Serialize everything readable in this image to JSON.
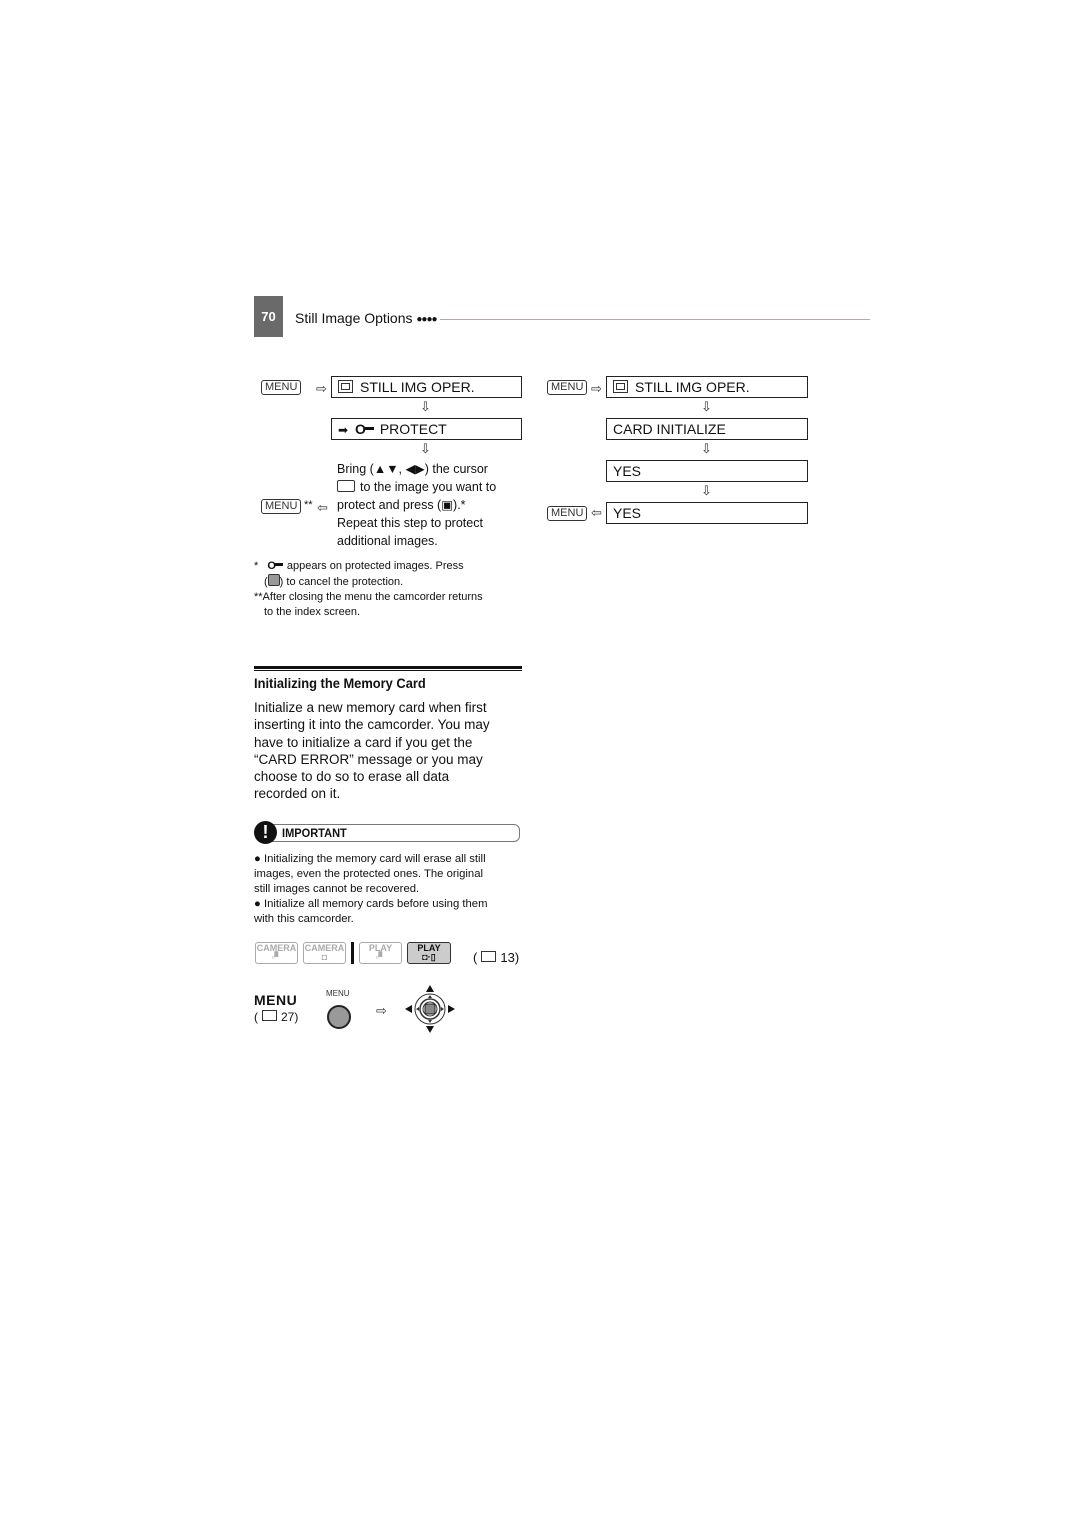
{
  "header": {
    "page_number": "70",
    "section_title": "Still Image Options",
    "dots": "●●●●"
  },
  "icons": {
    "menu_key": "MENU",
    "arrow_right": "⇨",
    "arrow_left": "⇦",
    "arrow_down": "⇩",
    "still_img_icon": "▧",
    "protect_arrow": "➡",
    "key_icon": "O┱"
  },
  "protect_flow": {
    "step1": "STILL IMG OPER.",
    "step2": "PROTECT",
    "instruction_lines": [
      "Bring (▲▼, ◀▶) the cursor",
      "to the image you want to",
      "protect and press (▣).*",
      "Repeat this step to protect",
      "additional images."
    ],
    "return_marker": "**"
  },
  "footnotes": {
    "note1_a": "appears on protected images. Press",
    "note1_b": "to cancel the protection.",
    "note2_a": "**After closing the menu the camcorder returns",
    "note2_b": "to the index screen.",
    "star": "*"
  },
  "card_init_flow": {
    "step1": "STILL IMG OPER.",
    "step2": "CARD INITIALIZE",
    "step3": "YES",
    "step4": "YES"
  },
  "section": {
    "title": "Initializing the Memory Card",
    "paragraph_lines": [
      "Initialize a new memory card when first",
      "inserting it into the camcorder. You may",
      "have to initialize a card if you get the",
      "“CARD ERROR” message or you may",
      "choose to do so to erase all data",
      "recorded on it."
    ]
  },
  "important": {
    "label": "IMPORTANT",
    "bullet_lines": [
      "● Initializing the memory card will erase all still",
      "images, even the protected ones. The original",
      "still images cannot be recovered.",
      "● Initialize all memory cards before using them",
      "with this camcorder."
    ]
  },
  "modes": {
    "buttons": [
      {
        "top": "CAMERA",
        "bottom": "▫▘",
        "active": false
      },
      {
        "top": "CAMERA",
        "bottom": "◘",
        "active": false
      },
      {
        "top": "PLAY",
        "bottom": "▫▘",
        "active": false
      },
      {
        "top": "PLAY",
        "bottom": "◘·▯",
        "active": true
      }
    ],
    "page_ref": "( 13)",
    "page_ref_num": "13"
  },
  "menu_ref": {
    "label": "MENU",
    "page_ref_num": "27",
    "button_caption": "MENU"
  }
}
